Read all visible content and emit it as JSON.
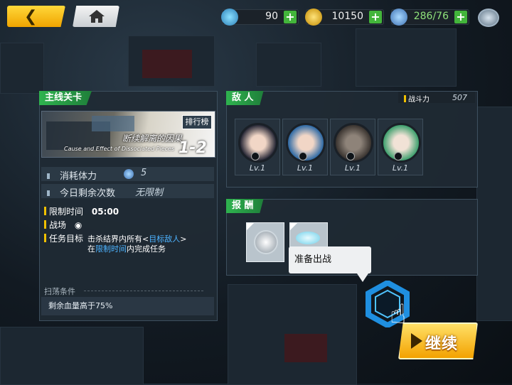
{
  "resources": {
    "gems": "90",
    "coins": "10150",
    "stamina": "286/76"
  },
  "main_stage": {
    "tag": "主线关卡",
    "rank_label": "排行榜",
    "stage_name": "断续解离的因果",
    "stage_subtitle": "Cause and Effect of Dissociated Pieces",
    "stage_number": "1-2",
    "stamina_cost_label": "消耗体力",
    "stamina_cost_value": "5",
    "daily_remaining_label": "今日剩余次数",
    "daily_remaining_value": "无限制",
    "time_limit_label": "限制时间",
    "time_limit_value": "05:00",
    "battlefield_label": "战场",
    "objective_label": "任务目标",
    "objective_line1_a": "击杀结界内所有<",
    "objective_line1_hl": "目标敌人",
    "objective_line1_b": ">",
    "objective_line2_a": "在",
    "objective_line2_hl": "限制时间",
    "objective_line2_b": "内完成任务",
    "sweep_title": "扫荡条件",
    "sweep_condition": "剩余血量高于75%"
  },
  "enemies": {
    "tag": "敌 人",
    "power_label": "战斗力",
    "power_value": "507",
    "list": [
      {
        "level": "Lv.1"
      },
      {
        "level": "Lv.1"
      },
      {
        "level": "Lv.1"
      },
      {
        "level": "Lv.1"
      }
    ]
  },
  "rewards": {
    "tag": "报 酬"
  },
  "tooltip": "准备出战",
  "continue_label": "继续",
  "colors": {
    "accent_green": "#2fb34f",
    "accent_yellow": "#f0c000",
    "highlight_blue": "#4db3ff"
  }
}
